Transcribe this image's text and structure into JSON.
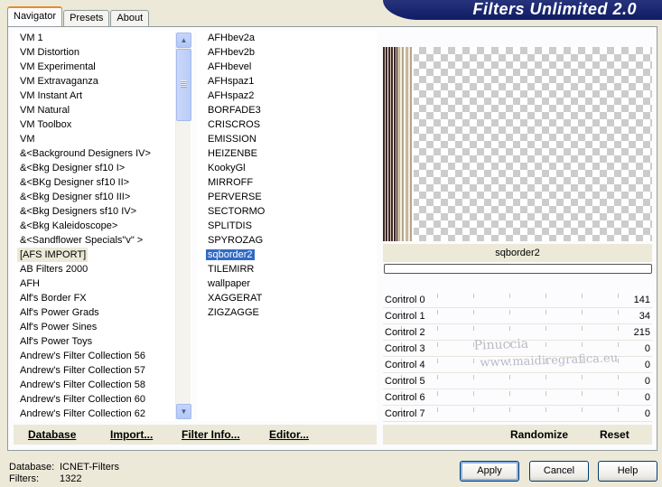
{
  "app": {
    "title": "Filters Unlimited 2.0"
  },
  "tabs": [
    {
      "label": "Navigator",
      "active": true
    },
    {
      "label": "Presets",
      "active": false
    },
    {
      "label": "About",
      "active": false
    }
  ],
  "categories": {
    "items": [
      "VM 1",
      "VM Distortion",
      "VM Experimental",
      "VM Extravaganza",
      "VM Instant Art",
      "VM Natural",
      "VM Toolbox",
      "VM",
      "&<Background Designers IV>",
      "&<Bkg Designer sf10 I>",
      "&<BKg Designer sf10 II>",
      "&<Bkg Designer sf10 III>",
      "&<Bkg Designers sf10 IV>",
      "&<Bkg Kaleidoscope>",
      "&<Sandflower Specials\"v\" >",
      "[AFS IMPORT]",
      "AB Filters 2000",
      "AFH",
      "Alf's Border FX",
      "Alf's Power Grads",
      "Alf's Power Sines",
      "Alf's Power Toys",
      "Andrew's Filter Collection 56",
      "Andrew's Filter Collection 57",
      "Andrew's Filter Collection 58",
      "Andrew's Filter Collection 60",
      "Andrew's Filter Collection 62"
    ],
    "selected": "[AFS IMPORT]"
  },
  "filters": {
    "items": [
      "AFHbev2a",
      "AFHbev2b",
      "AFHbevel",
      "AFHspaz1",
      "AFHspaz2",
      "BORFADE3",
      "CRISCROS",
      "EMISSION",
      "HEIZENBE",
      "KookyGl",
      "MIRROFF",
      "PERVERSE",
      "SECTORMO",
      "SPLITDIS",
      "SPYROZAG",
      "sqborder2",
      "TILEMIRR",
      "wallpaper",
      "XAGGERAT",
      "ZIGZAGGE"
    ],
    "selected": "sqborder2"
  },
  "preview": {
    "filter_name": "sqborder2"
  },
  "controls": [
    {
      "label": "Control 0",
      "value": "141"
    },
    {
      "label": "Control 1",
      "value": "34"
    },
    {
      "label": "Control 2",
      "value": "215"
    },
    {
      "label": "Control 3",
      "value": "0"
    },
    {
      "label": "Control 4",
      "value": "0"
    },
    {
      "label": "Control 5",
      "value": "0"
    },
    {
      "label": "Control 6",
      "value": "0"
    },
    {
      "label": "Control 7",
      "value": "0"
    }
  ],
  "watermark": {
    "line1": "Pinuccia",
    "line2": "www.maidiregrafica.eu"
  },
  "toolbar": {
    "database": "Database",
    "import": "Import...",
    "filter_info": "Filter Info...",
    "editor": "Editor...",
    "randomize": "Randomize",
    "reset": "Reset"
  },
  "status": {
    "database_label": "Database:",
    "database_value": "ICNET-Filters",
    "filters_label": "Filters:",
    "filters_value": "1322"
  },
  "buttons": {
    "apply": "Apply",
    "cancel": "Cancel",
    "help": "Help"
  }
}
